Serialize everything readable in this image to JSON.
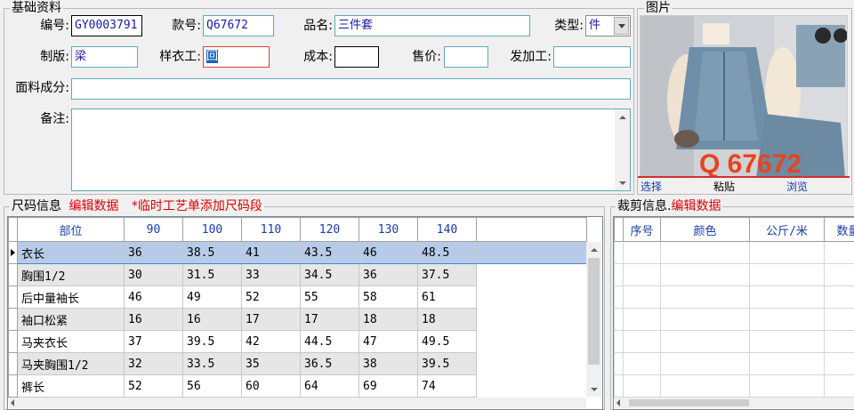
{
  "basic": {
    "legend": "基础资料",
    "bianhao_label": "编号:",
    "bianhao_value": "GY0003791",
    "kuanhao_label": "款号:",
    "kuanhao_value": "Q67672",
    "pinming_label": "品名:",
    "pinming_value": "三件套",
    "leixing_label": "类型:",
    "leixing_value": "件",
    "zhiban_label": "制版:",
    "zhiban_value": "梁",
    "yangyigong_label": "样衣工:",
    "yangyigong_value": "回",
    "chengben_label": "成本:",
    "chengben_value": "",
    "shoujia_label": "售价:",
    "shoujia_value": "",
    "fajiagong_label": "发加工:",
    "fajiagong_value": "",
    "mianliao_label": "面料成分:",
    "mianliao_value": "",
    "beizhu_label": "备注:",
    "beizhu_value": ""
  },
  "picture": {
    "legend": "图片",
    "watermark": "Q 67672",
    "choose_label": "选择",
    "paste_label": "粘贴",
    "browse_label": "浏览"
  },
  "size_info": {
    "legend": "尺码信息",
    "edit_label": "编辑数据",
    "temp_label": "*临时工艺单添加尺码段",
    "columns": [
      "部位",
      "90",
      "100",
      "110",
      "120",
      "130",
      "140"
    ],
    "rows": [
      [
        "衣长",
        "36",
        "38.5",
        "41",
        "43.5",
        "46",
        "48.5"
      ],
      [
        "胸围1/2",
        "30",
        "31.5",
        "33",
        "34.5",
        "36",
        "37.5"
      ],
      [
        "后中量袖长",
        "46",
        "49",
        "52",
        "55",
        "58",
        "61"
      ],
      [
        "袖口松紧",
        "16",
        "16",
        "17",
        "17",
        "18",
        "18"
      ],
      [
        "马夹衣长",
        "37",
        "39.5",
        "42",
        "44.5",
        "47",
        "49.5"
      ],
      [
        "马夹胸围1/2",
        "32",
        "33.5",
        "35",
        "36.5",
        "38",
        "39.5"
      ],
      [
        "裤长",
        "52",
        "56",
        "60",
        "64",
        "69",
        "74"
      ]
    ]
  },
  "cut_info": {
    "legend": "裁剪信息.",
    "edit_label": "编辑数据",
    "columns": [
      "序号",
      "颜色",
      "公斤/米",
      "数量"
    ]
  },
  "colors": {
    "accent_red": "#e00000",
    "header_blue": "#1a3aa6",
    "selected_row": "#b7cbe8"
  }
}
